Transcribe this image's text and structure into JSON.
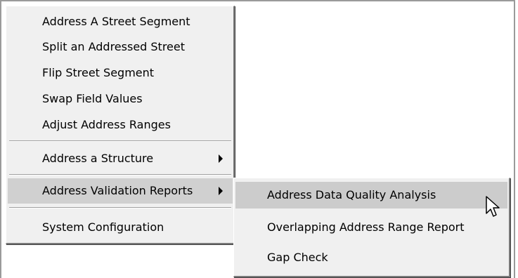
{
  "main_menu": {
    "items": [
      {
        "label": "Address A Street Segment"
      },
      {
        "label": "Split an Addressed Street"
      },
      {
        "label": "Flip Street Segment"
      },
      {
        "label": "Swap Field Values"
      },
      {
        "label": "Adjust Address Ranges"
      },
      {
        "label": "Address a Structure",
        "has_submenu": true
      },
      {
        "label": "Address Validation Reports",
        "has_submenu": true,
        "state": "open"
      },
      {
        "label": "System Configuration"
      }
    ]
  },
  "submenu": {
    "items": [
      {
        "label": "Address Data Quality Analysis",
        "state": "hovered"
      },
      {
        "label": "Overlapping Address Range Report"
      },
      {
        "label": "Gap Check"
      }
    ]
  },
  "icons": {
    "submenu_arrow": "triangle-right-icon",
    "cursor": "mouse-pointer-icon"
  },
  "colors": {
    "menu_background": "#f0f0f0",
    "highlight": "#d0d0d0",
    "text": "#000000"
  }
}
